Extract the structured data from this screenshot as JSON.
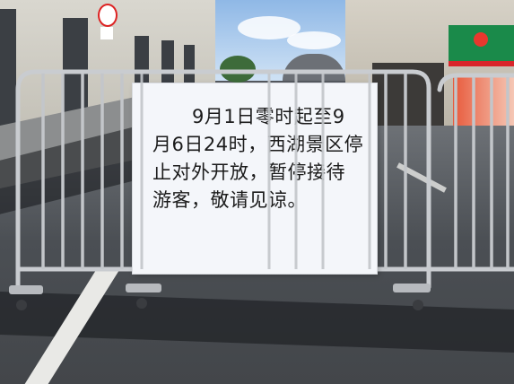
{
  "scene": {
    "notice": {
      "text": "9月1日零时起至9月6日24时，西湖景区停止对外开放，暂停接待游客，敬请见谅。"
    },
    "colors": {
      "barrier": "#c9ccd0",
      "paper": "#f4f6fa",
      "ink": "#1b1b1b",
      "road": "#4b4f54",
      "sky": "#8fb8e6",
      "store_green": "#1a8a4a",
      "store_red": "#d9262b"
    },
    "icons": [
      "no-right-turn-sign-icon",
      "convenience-store-logo-icon"
    ]
  }
}
